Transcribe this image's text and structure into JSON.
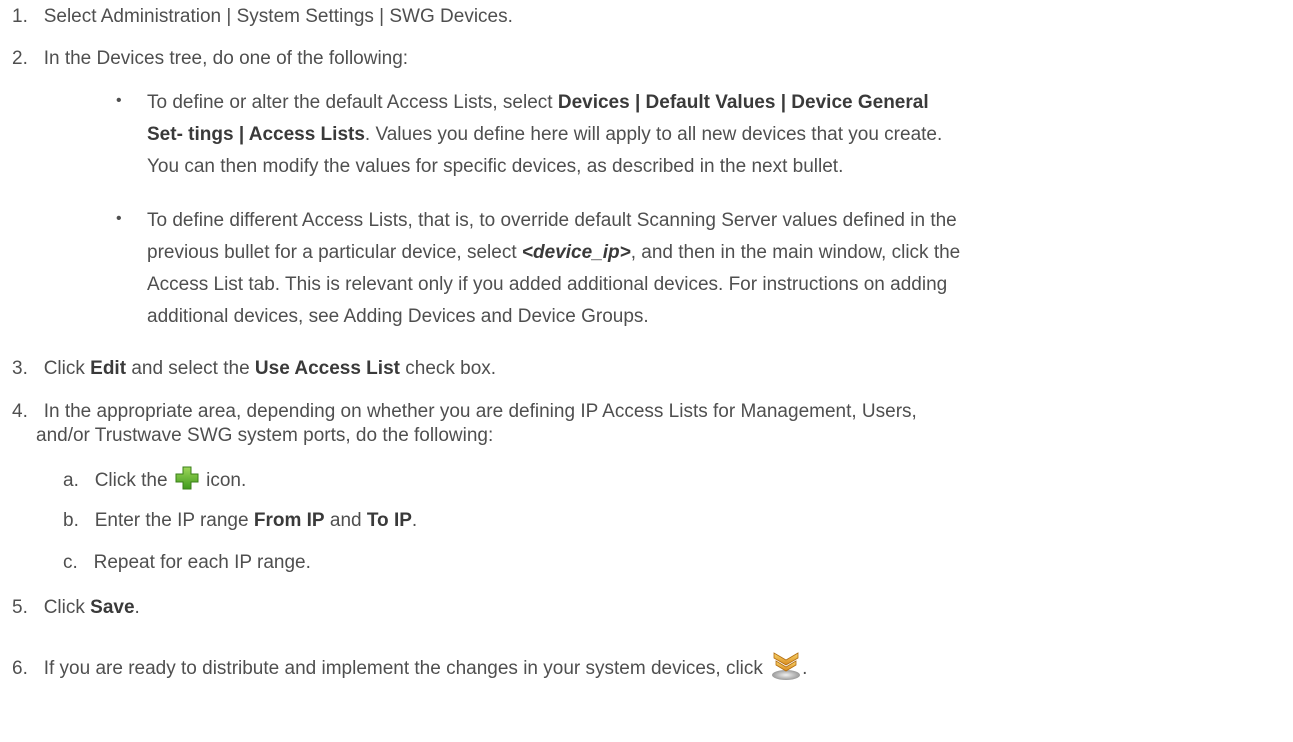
{
  "steps": [
    {
      "num": "1.",
      "text": "Select Administration | System Settings | SWG Devices."
    },
    {
      "num": "2.",
      "text": "In the Devices tree, do one of the following:"
    },
    {
      "num": "3.",
      "p1": "Click ",
      "b1": "Edit",
      "p2": " and select the ",
      "b2": "Use Access List",
      "p3": " check box."
    },
    {
      "num": "4.",
      "line1": "In the appropriate area, depending on whether you are defining IP Access Lists for Management, Users,",
      "line2": "and/or Trustwave SWG system ports, do the following:"
    },
    {
      "num": "5.",
      "p1": "Click ",
      "b1": "Save",
      "p2": "."
    },
    {
      "num": "6.",
      "text": "If you are ready to distribute and implement the changes in your system devices, click ",
      "end": "."
    }
  ],
  "bullets": [
    {
      "glyph": "•",
      "l1_pre": "To define or alter the default Access Lists, select ",
      "l1_bold": "Devices | Default Values | Device General",
      "l2_bold": "Set- tings | Access Lists",
      "l2_post": ". Values you define here will apply to all new devices that you create.",
      "l3": "You can then modify the values for specific devices, as described in the next bullet."
    },
    {
      "glyph": "•",
      "l1": "To define different Access Lists, that is, to override default Scanning Server values defined in the",
      "l2_pre": "previous bullet for a particular device, select ",
      "l2_em": "<device_ip>",
      "l2_post": ", and then in the main window, click the",
      "l3": "Access List tab. This is relevant only if you added additional devices. For instructions on adding",
      "l4": "additional devices, see Adding Devices and Device Groups."
    }
  ],
  "substeps": [
    {
      "letter": "a.",
      "pre": "Click the ",
      "post": " icon.",
      "icon": "plus-icon"
    },
    {
      "letter": "b.",
      "p1": "Enter the IP range ",
      "b1": "From IP",
      "p2": " and ",
      "b2": "To IP",
      "p3": "."
    },
    {
      "letter": "c.",
      "text": "Repeat for each IP range."
    }
  ],
  "icons": {
    "add": "plus-icon",
    "deploy": "deploy-icon"
  },
  "colors": {
    "text": "#4f4f4f",
    "bold": "#3a3a3a",
    "plus_green": "#6dbb2e",
    "deploy_orange": "#e0a23a"
  }
}
